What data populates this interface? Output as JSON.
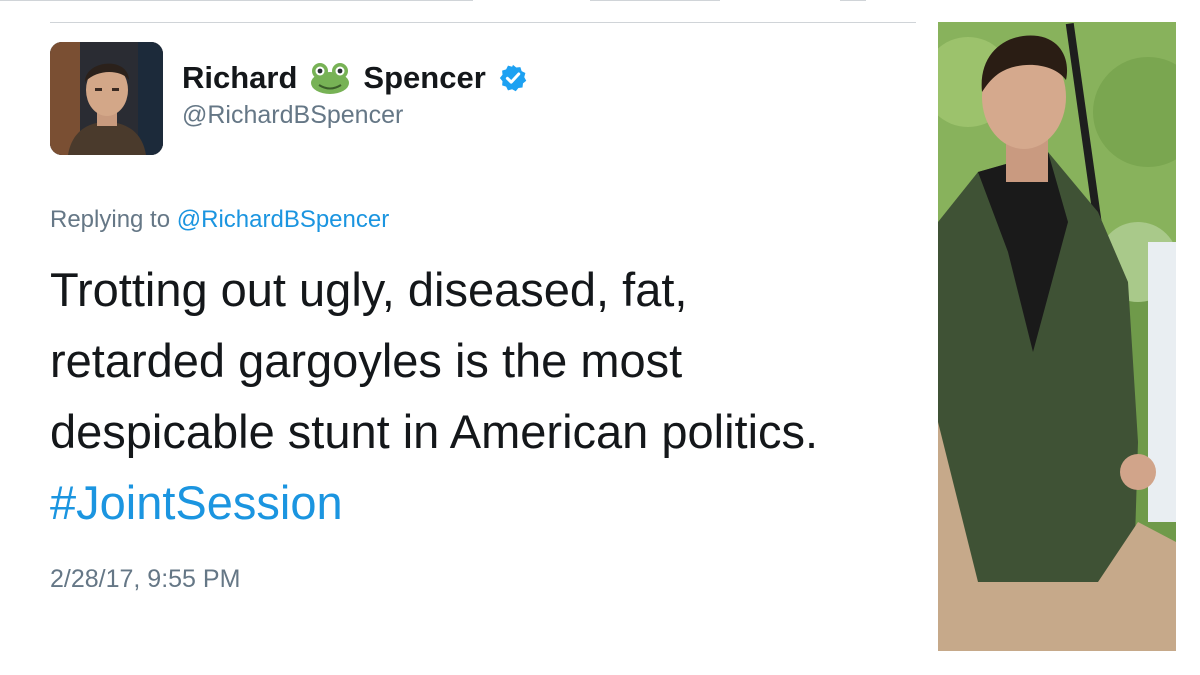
{
  "tweet": {
    "display_name_first": "Richard",
    "display_name_last": "Spencer",
    "name_emoji": "frog-emoji",
    "verified": true,
    "handle": "@RichardBSpencer",
    "replying_prefix": "Replying to",
    "replying_handle": "@RichardBSpencer",
    "text_lines": [
      "Trotting out ugly, diseased, fat,",
      "retarded gargoyles is the most",
      "despicable stunt in American politics."
    ],
    "hashtag": "#JointSession",
    "timestamp": "2/28/17, 9:55 PM"
  },
  "colors": {
    "link_blue": "#1b95e0",
    "verified_blue": "#1da1f2",
    "secondary_text": "#657786",
    "primary_text": "#14171a"
  },
  "icons": {
    "verified_badge": "verified-badge-icon",
    "avatar": "profile-avatar",
    "photo": "person-photo"
  }
}
